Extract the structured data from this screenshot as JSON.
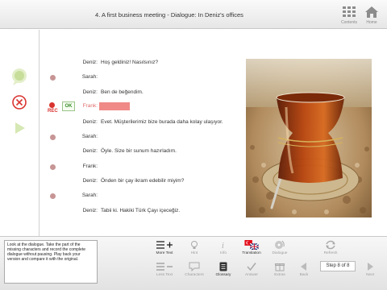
{
  "header": {
    "title": "4. A first business meeting - Dialogue: In Deniz's offices",
    "contents_label": "Contents",
    "home_label": "Home"
  },
  "dialogue": [
    {
      "speaker": "Deniz:",
      "text": "Hoş geldiniz! Nasılsınız?",
      "dot": false
    },
    {
      "speaker": "Sarah:",
      "text": "",
      "dot": true
    },
    {
      "speaker": "Deniz:",
      "text": "Ben de beğendim.",
      "dot": false
    },
    {
      "speaker": "Frank:",
      "text": "",
      "dot": false,
      "active": true
    },
    {
      "speaker": "Deniz:",
      "text": "Evet. Müşterilerimiz bize burada daha kolay ulaşıyor.",
      "dot": false
    },
    {
      "speaker": "Sarah:",
      "text": "",
      "dot": true
    },
    {
      "speaker": "Deniz:",
      "text": "Öyle. Size bir sunum hazırladım.",
      "dot": false
    },
    {
      "speaker": "Frank:",
      "text": "",
      "dot": true
    },
    {
      "speaker": "Deniz:",
      "text": "Önden bir çay ikram edebilir miyim?",
      "dot": false
    },
    {
      "speaker": "Sarah:",
      "text": "",
      "dot": true
    },
    {
      "speaker": "Deniz:",
      "text": "Tabii ki. Hakiki Türk Çayı içeceğiz.",
      "dot": false
    }
  ],
  "record": {
    "rec_label": "REC",
    "ok_label": "OK"
  },
  "instructions": "Look at the dialogue. Take the part of the missing characters and record the complete dialogue without pausing. Play back your version and compare it with the original.",
  "toolbar": {
    "more_text": "More Text",
    "less_text": "Less Text",
    "hint": "Hint",
    "characters": "Characters",
    "info": "Info",
    "glossary": "Glossary",
    "translation": "Translation",
    "answer": "Answer",
    "dialogue": "Dialogue",
    "extras": "Extras",
    "refresh": "Refresh",
    "back": "Back",
    "next": "Next",
    "step": "Step 8 of 8"
  },
  "colors": {
    "accent_red": "#d9332f",
    "blank_fill": "#ef8a87",
    "speaker_frank": "#e06a6a"
  }
}
